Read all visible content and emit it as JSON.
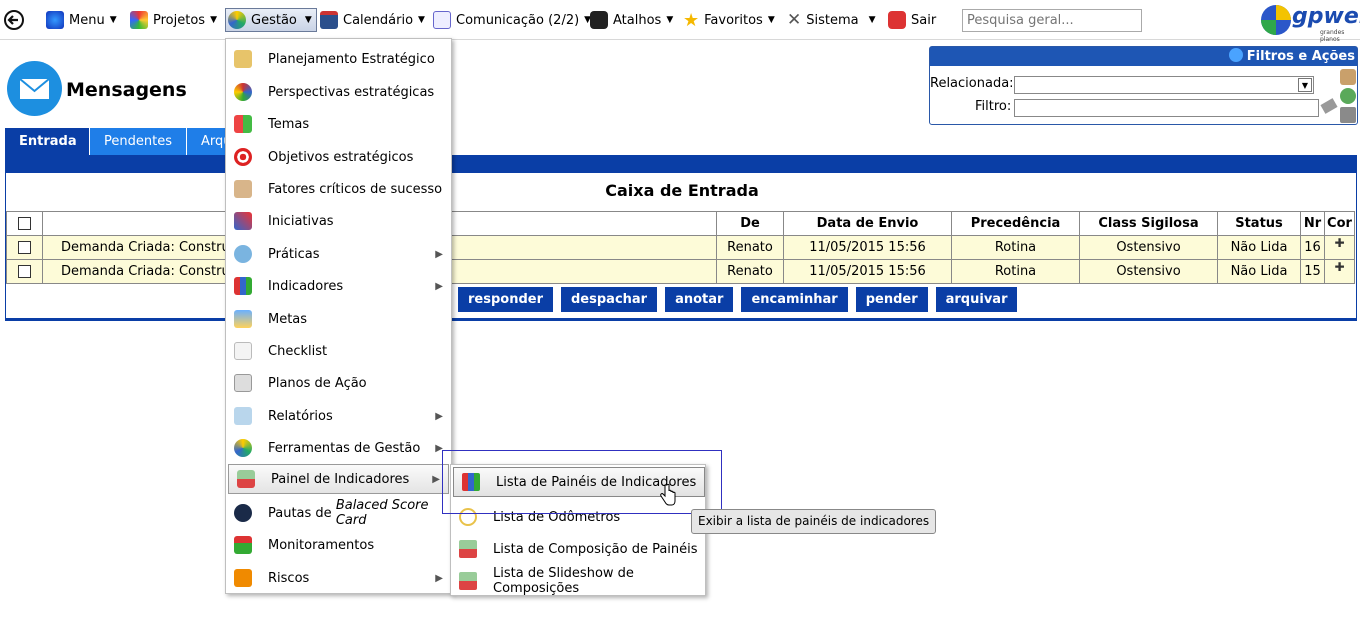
{
  "topbar": {
    "menu": "Menu",
    "projetos": "Projetos",
    "gestao": "Gestão",
    "calendario": "Calendário",
    "comunicacao": "Comunicação (2/2)",
    "atalhos": "Atalhos",
    "favoritos": "Favoritos",
    "sistema": "Sistema",
    "sair": "Sair",
    "search_placeholder": "Pesquisa geral...",
    "logo_text": "gpweb",
    "logo_sub": "grandes planos"
  },
  "page": {
    "title": "Mensagens"
  },
  "filters": {
    "title": "Filtros e Ações",
    "relacionada_label": "Relacionada:",
    "filtro_label": "Filtro:"
  },
  "tabs": [
    "Entrada",
    "Pendentes",
    "Arqu"
  ],
  "inbox": {
    "title": "Caixa de Entrada",
    "columns": [
      "De",
      "Data de Envio",
      "Precedência",
      "Class Sigilosa",
      "Status",
      "Nr",
      "Cor"
    ],
    "rows": [
      {
        "assunto": "Demanda Criada: Constru",
        "de": "Renato",
        "data": "11/05/2015 15:56",
        "precedencia": "Rotina",
        "sigilo": "Ostensivo",
        "status": "Não Lida",
        "nr": "16"
      },
      {
        "assunto": "Demanda Criada: Constru",
        "de": "Renato",
        "data": "11/05/2015 15:56",
        "precedencia": "Rotina",
        "sigilo": "Ostensivo",
        "status": "Não Lida",
        "nr": "15"
      }
    ],
    "actions": [
      "responder",
      "despachar",
      "anotar",
      "encaminhar",
      "pender",
      "arquivar"
    ]
  },
  "gestao_menu": [
    "Planejamento Estratégico",
    "Perspectivas estratégicas",
    "Temas",
    "Objetivos estratégicos",
    "Fatores críticos de sucesso",
    "Iniciativas",
    "Práticas",
    "Indicadores",
    "Metas",
    "Checklist",
    "Planos de Ação",
    "Relatórios",
    "Ferramentas de Gestão",
    "Painel de Indicadores",
    "Pautas de ",
    "Balaced Score Card",
    "Monitoramentos",
    "Riscos"
  ],
  "submenu": [
    "Lista de Painéis de Indicadores",
    "Lista de Odômetros",
    "Lista de Composição de Painéis",
    "Lista de Slideshow de Composições"
  ],
  "tooltip": "Exibir a lista de painéis de indicadores",
  "colors": {
    "primary": "#0a3ea6",
    "tab_light": "#1f7ee8",
    "row_bg": "#fdfbd8"
  }
}
